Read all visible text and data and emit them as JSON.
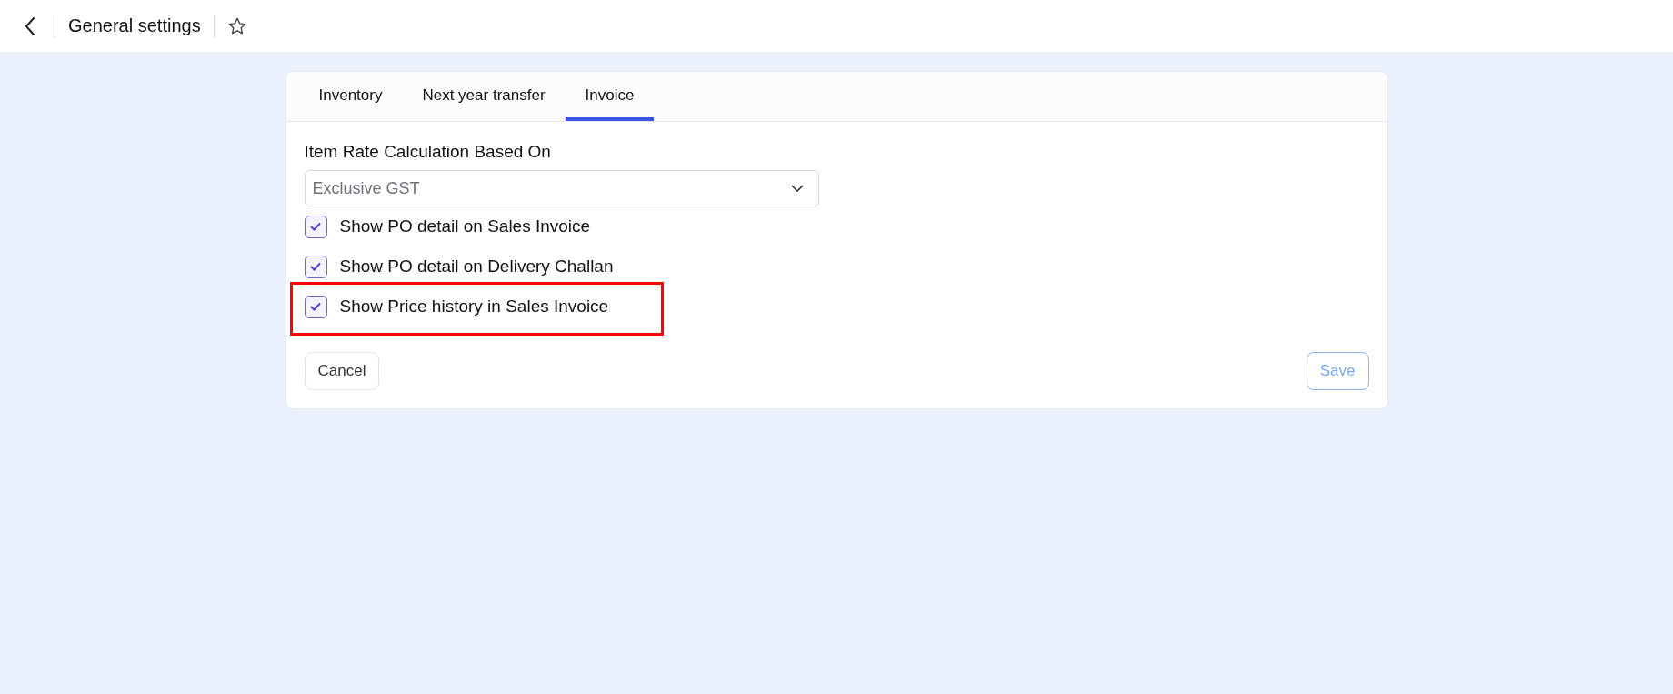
{
  "header": {
    "title": "General settings",
    "starred": false
  },
  "tabs": [
    {
      "label": "Inventory",
      "selected": false
    },
    {
      "label": "Next year transfer",
      "selected": false
    },
    {
      "label": "Invoice",
      "selected": true
    }
  ],
  "form": {
    "select": {
      "label": "Item Rate Calculation Based On",
      "value": "Exclusive GST"
    },
    "options": [
      {
        "label": "Show PO detail on Sales Invoice",
        "checked": true,
        "highlighted": false
      },
      {
        "label": "Show PO detail on Delivery Challan",
        "checked": true,
        "highlighted": false
      },
      {
        "label": "Show Price history in Sales Invoice",
        "checked": true,
        "highlighted": true
      }
    ]
  },
  "buttons": {
    "cancel": {
      "label": "Cancel"
    },
    "save": {
      "label": "Save",
      "disabled": true
    }
  }
}
